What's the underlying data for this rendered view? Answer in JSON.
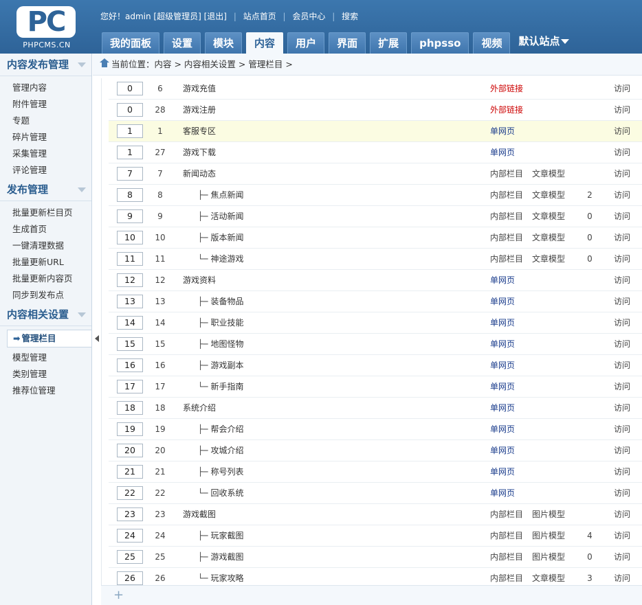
{
  "logo": {
    "mark": "PC",
    "site": "PHPCMS.CN"
  },
  "topbar": {
    "greeting": "您好！admin [超级管理员]",
    "logout": "[退出]",
    "home": "站点首页",
    "member": "会员中心",
    "search": "搜索"
  },
  "nav": {
    "tabs": [
      "我的面板",
      "设置",
      "模块",
      "内容",
      "用户",
      "界面",
      "扩展",
      "phpsso",
      "视频"
    ],
    "active": "内容",
    "site_select": "默认站点"
  },
  "sidebar": {
    "sections": [
      {
        "title": "内容发布管理",
        "items": [
          "管理内容",
          "附件管理",
          "专题",
          "碎片管理",
          "采集管理",
          "评论管理"
        ]
      },
      {
        "title": "发布管理",
        "items": [
          "批量更新栏目页",
          "生成首页",
          "一键清理数据",
          "批量更新URL",
          "批量更新内容页",
          "同步到发布点"
        ]
      },
      {
        "title": "内容相关设置",
        "items": [
          "管理栏目",
          "模型管理",
          "类别管理",
          "推荐位管理"
        ]
      }
    ],
    "active_item": "管理栏目"
  },
  "breadcrumb": "当前位置：内容 > 内容相关设置 > 管理栏目 >",
  "rows": [
    {
      "order": "0",
      "id": "6",
      "name": "游戏充值",
      "level": 0,
      "branch": "",
      "type": "外部链接",
      "kind": "ext",
      "model": "",
      "count": "",
      "visit": "访问"
    },
    {
      "order": "0",
      "id": "28",
      "name": "游戏注册",
      "level": 0,
      "branch": "",
      "type": "外部链接",
      "kind": "ext",
      "model": "",
      "count": "",
      "visit": "访问"
    },
    {
      "order": "1",
      "id": "1",
      "name": "客服专区",
      "level": 0,
      "branch": "",
      "type": "单网页",
      "kind": "page",
      "model": "",
      "count": "",
      "visit": "访问",
      "highlight": true
    },
    {
      "order": "1",
      "id": "27",
      "name": "游戏下载",
      "level": 0,
      "branch": "",
      "type": "单网页",
      "kind": "page",
      "model": "",
      "count": "",
      "visit": "访问"
    },
    {
      "order": "7",
      "id": "7",
      "name": "新闻动态",
      "level": 0,
      "branch": "",
      "type": "内部栏目",
      "kind": "inner",
      "model": "文章模型",
      "count": "",
      "visit": "访问"
    },
    {
      "order": "8",
      "id": "8",
      "name": "焦点新闻",
      "level": 1,
      "branch": "├─",
      "type": "内部栏目",
      "kind": "inner",
      "model": "文章模型",
      "count": "2",
      "visit": "访问"
    },
    {
      "order": "9",
      "id": "9",
      "name": "活动新闻",
      "level": 1,
      "branch": "├─",
      "type": "内部栏目",
      "kind": "inner",
      "model": "文章模型",
      "count": "0",
      "visit": "访问"
    },
    {
      "order": "10",
      "id": "10",
      "name": "版本新闻",
      "level": 1,
      "branch": "├─",
      "type": "内部栏目",
      "kind": "inner",
      "model": "文章模型",
      "count": "0",
      "visit": "访问"
    },
    {
      "order": "11",
      "id": "11",
      "name": "神途游戏",
      "level": 1,
      "branch": "└─",
      "type": "内部栏目",
      "kind": "inner",
      "model": "文章模型",
      "count": "0",
      "visit": "访问"
    },
    {
      "order": "12",
      "id": "12",
      "name": "游戏资料",
      "level": 0,
      "branch": "",
      "type": "单网页",
      "kind": "page",
      "model": "",
      "count": "",
      "visit": "访问"
    },
    {
      "order": "13",
      "id": "13",
      "name": "装备物品",
      "level": 1,
      "branch": "├─",
      "type": "单网页",
      "kind": "page",
      "model": "",
      "count": "",
      "visit": "访问"
    },
    {
      "order": "14",
      "id": "14",
      "name": "职业技能",
      "level": 1,
      "branch": "├─",
      "type": "单网页",
      "kind": "page",
      "model": "",
      "count": "",
      "visit": "访问"
    },
    {
      "order": "15",
      "id": "15",
      "name": "地图怪物",
      "level": 1,
      "branch": "├─",
      "type": "单网页",
      "kind": "page",
      "model": "",
      "count": "",
      "visit": "访问"
    },
    {
      "order": "16",
      "id": "16",
      "name": "游戏副本",
      "level": 1,
      "branch": "├─",
      "type": "单网页",
      "kind": "page",
      "model": "",
      "count": "",
      "visit": "访问"
    },
    {
      "order": "17",
      "id": "17",
      "name": "新手指南",
      "level": 1,
      "branch": "└─",
      "type": "单网页",
      "kind": "page",
      "model": "",
      "count": "",
      "visit": "访问"
    },
    {
      "order": "18",
      "id": "18",
      "name": "系统介绍",
      "level": 0,
      "branch": "",
      "type": "单网页",
      "kind": "page",
      "model": "",
      "count": "",
      "visit": "访问"
    },
    {
      "order": "19",
      "id": "19",
      "name": "帮会介绍",
      "level": 1,
      "branch": "├─",
      "type": "单网页",
      "kind": "page",
      "model": "",
      "count": "",
      "visit": "访问"
    },
    {
      "order": "20",
      "id": "20",
      "name": "攻城介绍",
      "level": 1,
      "branch": "├─",
      "type": "单网页",
      "kind": "page",
      "model": "",
      "count": "",
      "visit": "访问"
    },
    {
      "order": "21",
      "id": "21",
      "name": "称号列表",
      "level": 1,
      "branch": "├─",
      "type": "单网页",
      "kind": "page",
      "model": "",
      "count": "",
      "visit": "访问"
    },
    {
      "order": "22",
      "id": "22",
      "name": "回收系统",
      "level": 1,
      "branch": "└─",
      "type": "单网页",
      "kind": "page",
      "model": "",
      "count": "",
      "visit": "访问"
    },
    {
      "order": "23",
      "id": "23",
      "name": "游戏截图",
      "level": 0,
      "branch": "",
      "type": "内部栏目",
      "kind": "inner",
      "model": "图片模型",
      "count": "",
      "visit": "访问"
    },
    {
      "order": "24",
      "id": "24",
      "name": "玩家截图",
      "level": 1,
      "branch": "├─",
      "type": "内部栏目",
      "kind": "inner",
      "model": "图片模型",
      "count": "4",
      "visit": "访问"
    },
    {
      "order": "25",
      "id": "25",
      "name": "游戏截图",
      "level": 1,
      "branch": "├─",
      "type": "内部栏目",
      "kind": "inner",
      "model": "图片模型",
      "count": "0",
      "visit": "访问"
    },
    {
      "order": "26",
      "id": "26",
      "name": "玩家攻略",
      "level": 1,
      "branch": "└─",
      "type": "内部栏目",
      "kind": "inner",
      "model": "文章模型",
      "count": "3",
      "visit": "访问"
    }
  ],
  "footer": {
    "add_icon": "plus-icon"
  }
}
